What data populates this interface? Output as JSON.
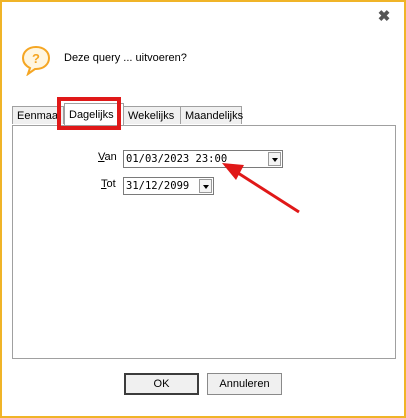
{
  "dialog": {
    "close_glyph": "✖",
    "prompt": "Deze query ... uitvoeren?",
    "icon": "question-bubble-icon"
  },
  "tabs": [
    {
      "label": "Eenmaal",
      "active": false
    },
    {
      "label": "Dagelijks",
      "active": true
    },
    {
      "label": "Wekelijks",
      "active": false
    },
    {
      "label": "Maandelijks",
      "active": false
    }
  ],
  "form": {
    "van": {
      "label_accel": "V",
      "label_rest": "an",
      "value": "01/03/2023 23:00"
    },
    "tot": {
      "label_accel": "T",
      "label_rest": "ot",
      "value": "31/12/2099"
    }
  },
  "buttons": {
    "ok": "OK",
    "cancel": "Annuleren"
  },
  "colors": {
    "frame": "#f0b428",
    "annotation": "#e01818",
    "icon": "#f5a623"
  }
}
